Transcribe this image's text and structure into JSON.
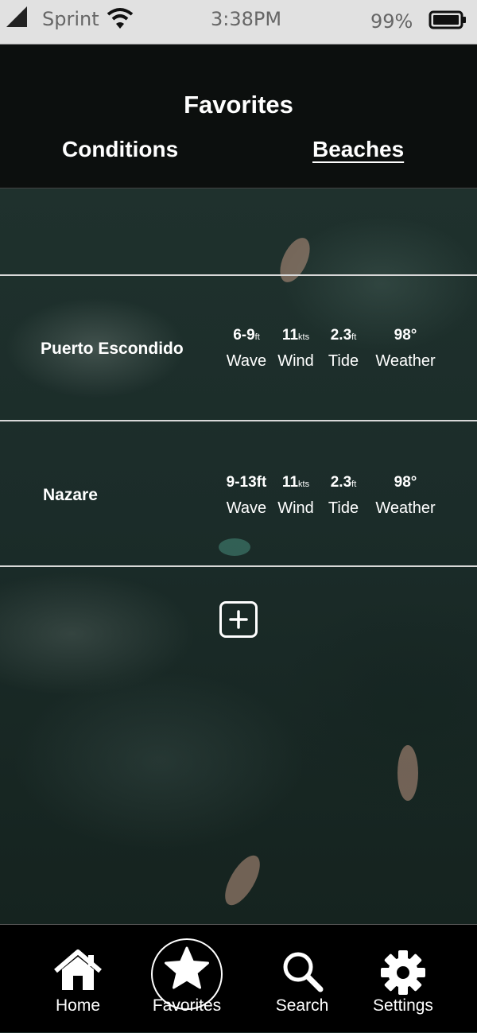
{
  "status_bar": {
    "carrier": "Sprint",
    "time": "3:38PM",
    "battery": "99%"
  },
  "header": {
    "title": "Favorites",
    "tabs": [
      {
        "label": "Conditions",
        "active": false
      },
      {
        "label": "Beaches",
        "active": true
      }
    ]
  },
  "beaches": [
    {
      "name": "Puerto Escondido",
      "stats": [
        {
          "value": "6-9",
          "unit": "ft",
          "label": "Wave"
        },
        {
          "value": "11",
          "unit": "kts",
          "label": "Wind"
        },
        {
          "value": "2.3",
          "unit": "ft",
          "label": "Tide"
        },
        {
          "value": "98°",
          "unit": "",
          "label": "Weather"
        }
      ]
    },
    {
      "name": "Nazare",
      "stats": [
        {
          "value": "9-13ft",
          "unit": "",
          "label": "Wave"
        },
        {
          "value": "11",
          "unit": "kts",
          "label": "Wind"
        },
        {
          "value": "2.3",
          "unit": "ft",
          "label": "Tide"
        },
        {
          "value": "98°",
          "unit": "",
          "label": "Weather"
        }
      ]
    }
  ],
  "add_button": {
    "icon": "plus-square-icon"
  },
  "tab_bar": {
    "items": [
      {
        "label": "Home",
        "icon": "home-icon"
      },
      {
        "label": "Favorites",
        "icon": "star-icon",
        "active": true
      },
      {
        "label": "Search",
        "icon": "search-icon"
      },
      {
        "label": "Settings",
        "icon": "gear-icon"
      }
    ]
  },
  "colors": {
    "header_bg": "#0c0f0e",
    "tab_bar_bg": "#000000",
    "ocean_bg": "#1b2c29",
    "text": "#ffffff"
  }
}
